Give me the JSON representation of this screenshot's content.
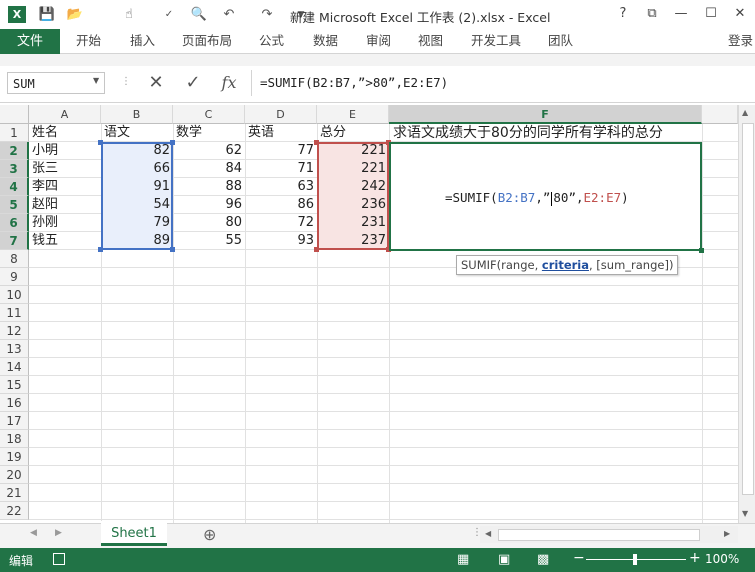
{
  "window": {
    "title": "新建 Microsoft Excel 工作表 (2).xlsx - Excel",
    "help": "?",
    "restore": "⧉",
    "minimize": "—",
    "maximize": "☐",
    "close": "✕"
  },
  "ribbon": {
    "file": "文件",
    "tabs": [
      "开始",
      "插入",
      "页面布局",
      "公式",
      "数据",
      "审阅",
      "视图",
      "开发工具",
      "团队"
    ],
    "login": "登录"
  },
  "formula_bar": {
    "name_box": "SUM",
    "cancel": "✕",
    "enter": "✓",
    "fx": "fx",
    "formula": "=SUMIF(B2:B7,”>80”,E2:E7)"
  },
  "sheet": {
    "columns": [
      "A",
      "B",
      "C",
      "D",
      "E",
      "F"
    ],
    "rows": [
      "1",
      "2",
      "3",
      "4",
      "5",
      "6",
      "7",
      "8",
      "9",
      "10",
      "11",
      "12",
      "13",
      "14",
      "15",
      "16",
      "17",
      "18",
      "19",
      "20",
      "21",
      "22"
    ],
    "headers": [
      "姓名",
      "语文",
      "数学",
      "英语",
      "总分"
    ],
    "f1": "求语文成绩大于80分的同学所有学科的总分",
    "data": [
      [
        "小明",
        "82",
        "62",
        "77",
        "221"
      ],
      [
        "张三",
        "66",
        "84",
        "71",
        "221"
      ],
      [
        "李四",
        "91",
        "88",
        "63",
        "242"
      ],
      [
        "赵阳",
        "54",
        "96",
        "86",
        "236"
      ],
      [
        "孙刚",
        "79",
        "80",
        "72",
        "231"
      ],
      [
        "钱五",
        "89",
        "55",
        "93",
        "237"
      ]
    ],
    "edit_formula": {
      "start": "=SUMIF(",
      "range1": "B2:B7",
      "mid1": ",”",
      "mid2": "80”,",
      "range2": "E2:E7",
      "end": ")"
    },
    "tooltip": {
      "prefix": "SUMIF(range, ",
      "bold": "criteria",
      "suffix": ", [sum_range])"
    }
  },
  "tabs": {
    "sheet1": "Sheet1",
    "add": "⊕"
  },
  "status": {
    "mode": "编辑",
    "zoom": "100%"
  },
  "colors": {
    "excel_green": "#217346",
    "range_blue": "#4472c4",
    "range_red": "#c0504d"
  }
}
